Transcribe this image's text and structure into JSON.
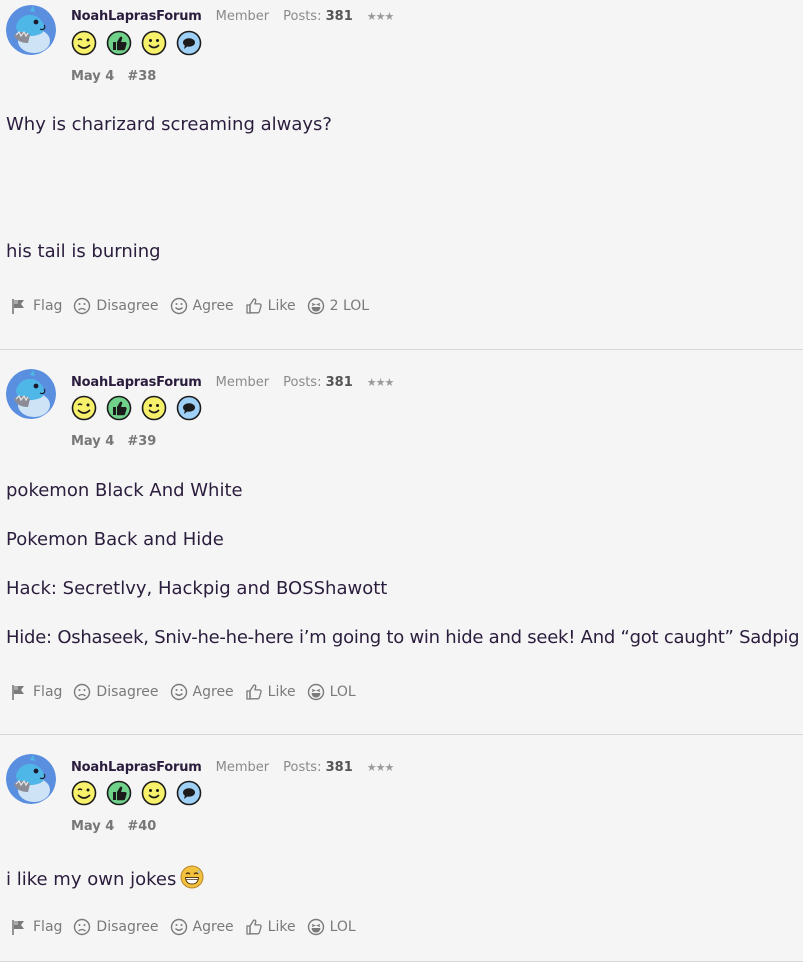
{
  "posts": [
    {
      "username": "NoahLaprasForum",
      "user_title": "Member",
      "posts_label": "Posts:",
      "posts_count": "381",
      "stars": "★★★",
      "date": "May 4",
      "number": "#38",
      "body": [
        "Why is charizard screaming always?",
        "his tail is burning"
      ],
      "actions": {
        "flag": "Flag",
        "disagree": "Disagree",
        "agree": "Agree",
        "like": "Like",
        "lol": "2 LOL"
      }
    },
    {
      "username": "NoahLaprasForum",
      "user_title": "Member",
      "posts_label": "Posts:",
      "posts_count": "381",
      "stars": "★★★",
      "date": "May 4",
      "number": "#39",
      "body": [
        "pokemon Black And White",
        "Pokemon Back and Hide",
        "Hack: Secretlvy, Hackpig and BOSShawott",
        "Hide: Oshaseek, Sniv-he-he-here i’m going to win hide and seek! And “got caught” Sadpig"
      ],
      "actions": {
        "flag": "Flag",
        "disagree": "Disagree",
        "agree": "Agree",
        "like": "Like",
        "lol": "LOL"
      }
    },
    {
      "username": "NoahLaprasForum",
      "user_title": "Member",
      "posts_label": "Posts:",
      "posts_count": "381",
      "stars": "★★★",
      "date": "May 4",
      "number": "#40",
      "body": [
        "i like my own jokes"
      ],
      "actions": {
        "flag": "Flag",
        "disagree": "Disagree",
        "agree": "Agree",
        "like": "Like",
        "lol": "LOL"
      }
    }
  ],
  "icons": {
    "badges": [
      "wink-face-icon",
      "thumbs-up-icon",
      "smiley-face-icon",
      "speech-bubble-icon"
    ],
    "flag": "flag-icon",
    "disagree": "frown-face-icon",
    "agree": "smile-face-icon",
    "like": "thumbs-up-outline-icon",
    "lol": "laugh-face-icon",
    "inline_emoji": "grinning-sweat-emoji"
  },
  "colors": {
    "background": "#f5f5f5",
    "text": "#2b1d3d",
    "muted": "#7a7a7a",
    "divider": "#d6d6d6",
    "avatar_bg": "#5a8fe0",
    "badge_yellow": "#f7f06a",
    "badge_green": "#6fd18a",
    "badge_blue": "#9fd0f5"
  }
}
